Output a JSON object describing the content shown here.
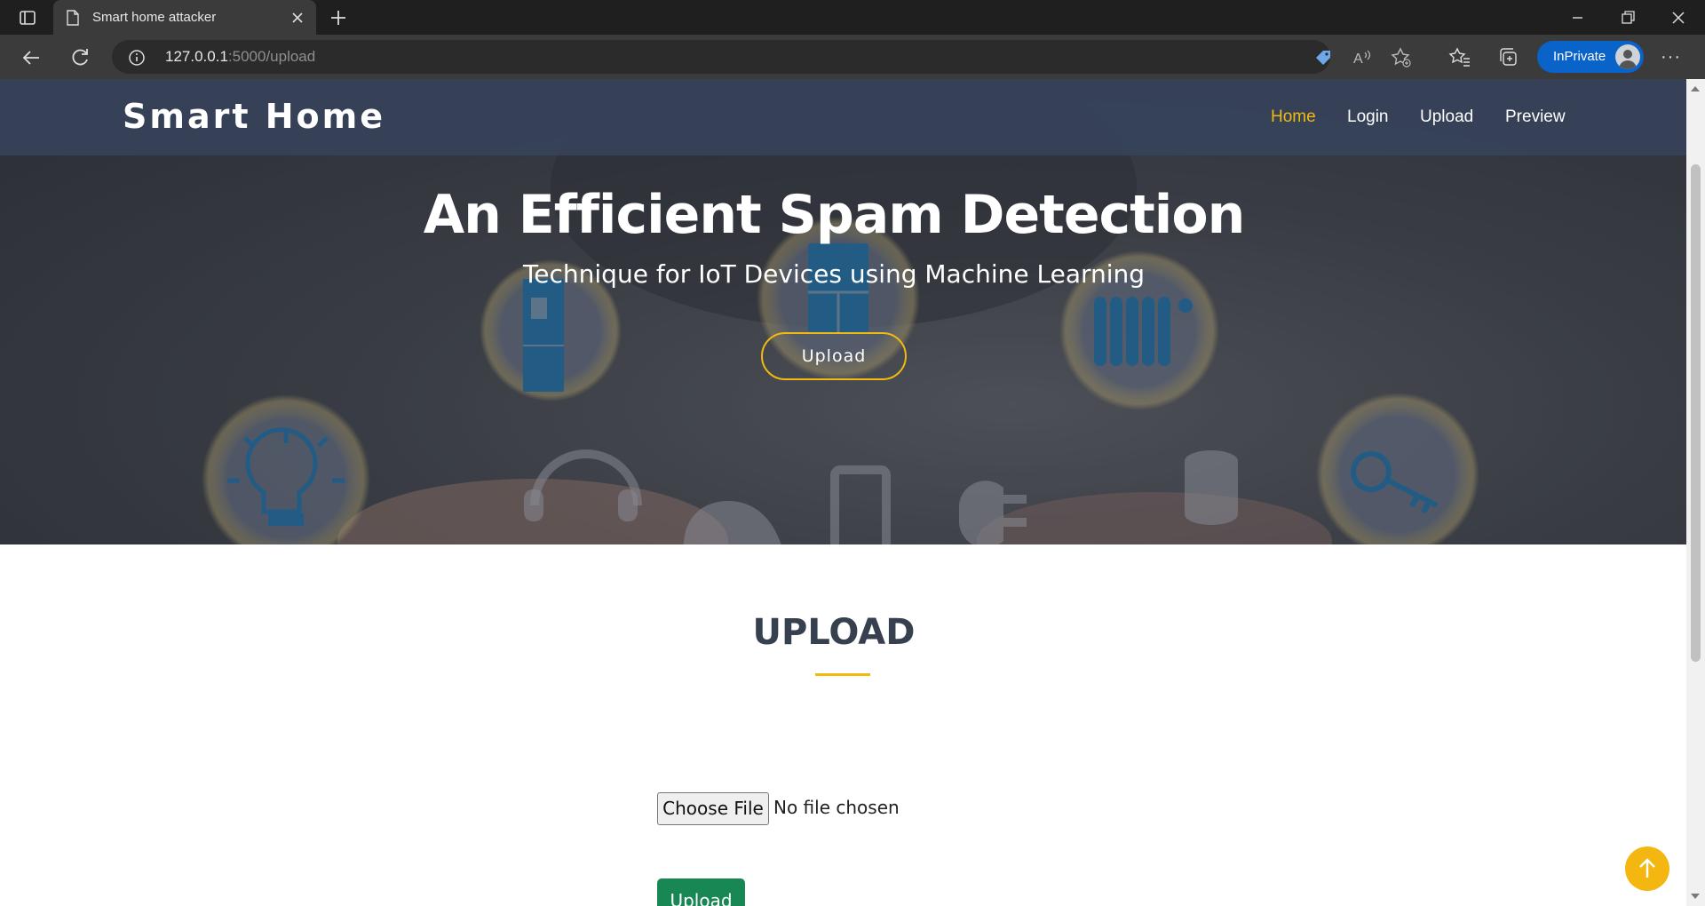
{
  "browser": {
    "tab_title": "Smart home attacker",
    "url_host": "127.0.0.1",
    "url_path": ":5000/upload",
    "inprivate_label": "InPrivate"
  },
  "site": {
    "logo": "Smart Home",
    "nav": [
      {
        "label": "Home",
        "active": true
      },
      {
        "label": "Login",
        "active": false
      },
      {
        "label": "Upload",
        "active": false
      },
      {
        "label": "Preview",
        "active": false
      }
    ]
  },
  "hero": {
    "title": "An Efficient Spam Detection",
    "subtitle": "Technique for IoT Devices using Machine Learning",
    "button": "Upload"
  },
  "section": {
    "title": "UPLOAD",
    "file_button": "Choose File",
    "file_status": "No file chosen",
    "submit": "Upload"
  },
  "colors": {
    "accent": "#f2b90f",
    "header_bg": "#37425a",
    "submit_bg": "#198754",
    "inprivate": "#0a63c9"
  },
  "icons": [
    "tab-actions-icon",
    "page-icon",
    "close-icon",
    "plus-icon",
    "minimize-icon",
    "restore-icon",
    "window-close-icon",
    "back-icon",
    "refresh-icon",
    "info-icon",
    "tag-icon",
    "read-aloud-icon",
    "add-favorite-icon",
    "favorites-icon",
    "collections-icon",
    "more-icon",
    "arrow-up-icon"
  ]
}
